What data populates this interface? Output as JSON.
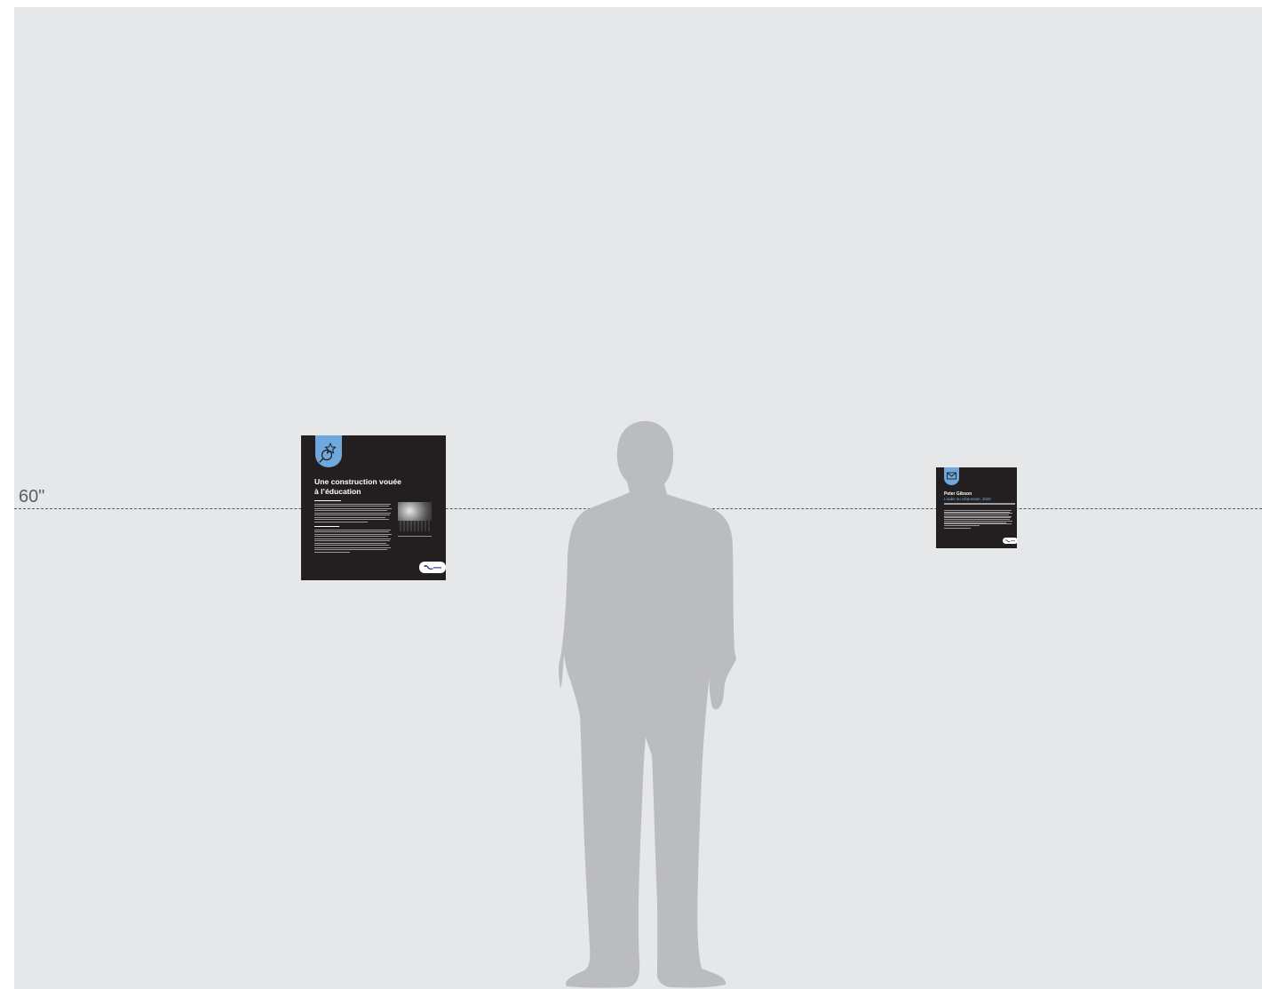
{
  "wall": {
    "color": "#e6e7e9"
  },
  "height_marker": {
    "label": "60\"",
    "color": "#555a60"
  },
  "silhouette": {
    "name": "person-silhouette",
    "color": "#bbbcbe"
  },
  "panels": [
    {
      "id": "large",
      "background": "#231f20",
      "tab_color": "#6ea8dc",
      "icon": "magnifier-star-icon",
      "title_line1": "Une construction vouée",
      "title_line2": "à l’éducation"
    },
    {
      "id": "small",
      "background": "#231f20",
      "tab_color": "#6ea8dc",
      "icon": "envelope-icon",
      "title": "Peter Gibson",
      "subtitle": "L’aube au crépuscule, 2023"
    }
  ]
}
